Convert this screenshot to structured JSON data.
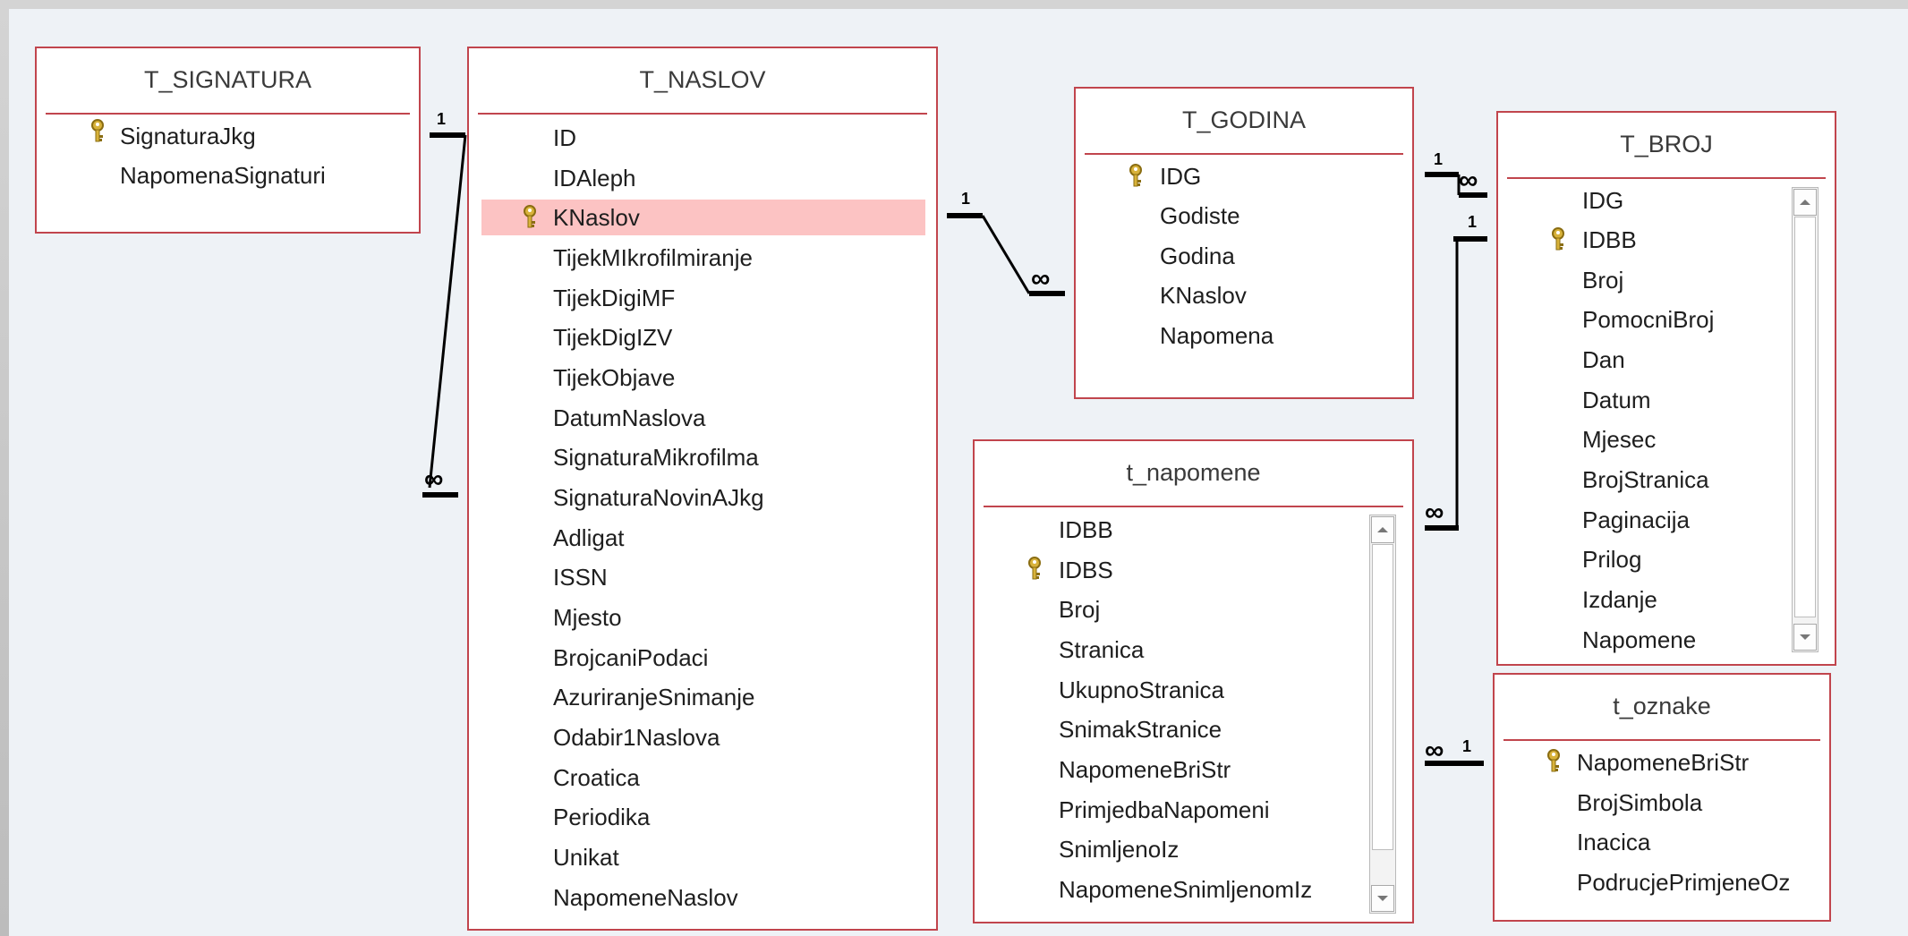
{
  "tables": {
    "signatura": {
      "title": "T_SIGNATURA",
      "fields": [
        "SignaturaJkg",
        "NapomenaSignaturi"
      ]
    },
    "naslov": {
      "title": "T_NASLOV",
      "fields": [
        "ID",
        "IDAleph",
        "KNaslov",
        "TijekMIkrofilmiranje",
        "TijekDigiMF",
        "TijekDigIZV",
        "TijekObjave",
        "DatumNaslova",
        "SignaturaMikrofilma",
        "SignaturaNovinAJkg",
        "Adligat",
        "ISSN",
        "Mjesto",
        "BrojcaniPodaci",
        "AzuriranjeSnimanje",
        "Odabir1Naslova",
        "Croatica",
        "Periodika",
        "Unikat",
        "NapomeneNaslov"
      ]
    },
    "godina": {
      "title": "T_GODINA",
      "fields": [
        "IDG",
        "Godiste",
        "Godina",
        "KNaslov",
        "Napomena"
      ]
    },
    "broj": {
      "title": "T_BROJ",
      "fields": [
        "IDG",
        "IDBB",
        "Broj",
        "PomocniBroj",
        "Dan",
        "Datum",
        "Mjesec",
        "BrojStranica",
        "Paginacija",
        "Prilog",
        "Izdanje",
        "Napomene"
      ]
    },
    "napomene": {
      "title": "t_napomene",
      "fields": [
        "IDBB",
        "IDBS",
        "Broj",
        "Stranica",
        "UkupnoStranica",
        "SnimakStranice",
        "NapomeneBriStr",
        "PrimjedbaNapomeni",
        "SnimljenoIz",
        "NapomeneSnimljenomIz"
      ]
    },
    "oznake": {
      "title": "t_oznake",
      "fields": [
        "NapomeneBriStr",
        "BrojSimbola",
        "Inacica",
        "PodrucjePrimjeneOz"
      ]
    }
  },
  "relationships": {
    "one_label": "1",
    "many_label": "∞"
  },
  "colors": {
    "table_border": "#c1454d",
    "selected_field": "#fcc3c3",
    "canvas": "#eef2f6",
    "key_icon": "#c9a42c"
  },
  "icons": {
    "primary_key": "key-icon",
    "scroll_up": "scroll-up-arrow-icon",
    "scroll_down": "scroll-down-arrow-icon"
  }
}
